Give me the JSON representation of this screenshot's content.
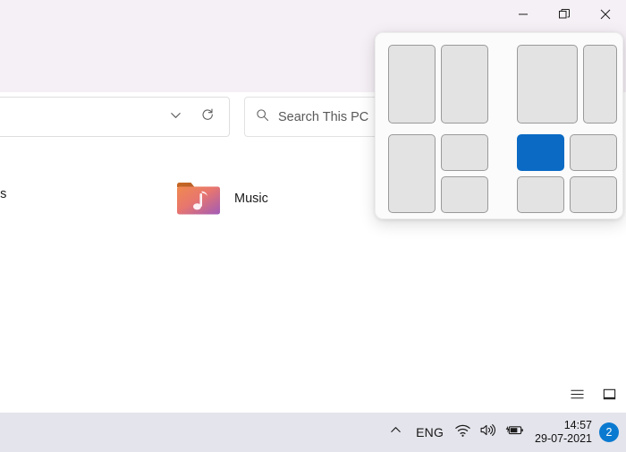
{
  "window": {
    "controls": [
      {
        "name": "minimize",
        "glyph": "minimize-icon",
        "label": "Minimize"
      },
      {
        "name": "restore",
        "glyph": "restore-icon",
        "label": "Restore Down"
      },
      {
        "name": "close",
        "glyph": "close-icon",
        "label": "Close"
      }
    ]
  },
  "toolbar": {
    "address_dropdown_icon": "chevron-down-icon",
    "refresh_icon": "refresh-icon",
    "search": {
      "icon": "search-icon",
      "placeholder": "Search This PC",
      "value": ""
    }
  },
  "content": {
    "items": [
      {
        "name": "downloads",
        "label": "ds",
        "icon": "folder-icon"
      },
      {
        "name": "music",
        "label": "Music",
        "icon": "music-folder-icon"
      }
    ]
  },
  "statusbar": {
    "view_buttons": [
      {
        "name": "details-view",
        "icon": "list-view-icon",
        "label": "Details view"
      },
      {
        "name": "large-icons-view",
        "icon": "large-icons-icon",
        "label": "Large icons view"
      }
    ]
  },
  "taskbar": {
    "show_hidden_icons": "chevron-up-icon",
    "language": "ENG",
    "tray_icons": [
      {
        "name": "network",
        "icon": "wifi-icon"
      },
      {
        "name": "volume",
        "icon": "speaker-icon"
      },
      {
        "name": "battery",
        "icon": "battery-charging-icon"
      }
    ],
    "clock": {
      "time": "14:57",
      "date": "29-07-2021"
    },
    "notification_badge": "2"
  },
  "snap_flyout": {
    "selected_color": "#0a6ac4",
    "tile_color": "#e3e3e3",
    "layouts": [
      {
        "name": "snap-layout-two-equal",
        "label": "Two equal columns",
        "selected_zone": null
      },
      {
        "name": "snap-layout-wide-left",
        "label": "Wide left, narrow right",
        "selected_zone": null
      },
      {
        "name": "snap-layout-left-plus-stack",
        "label": "Left column, two stacked right",
        "selected_zone": null
      },
      {
        "name": "snap-layout-quadrants",
        "label": "Four quadrants",
        "selected_zone": "top-left"
      }
    ]
  }
}
